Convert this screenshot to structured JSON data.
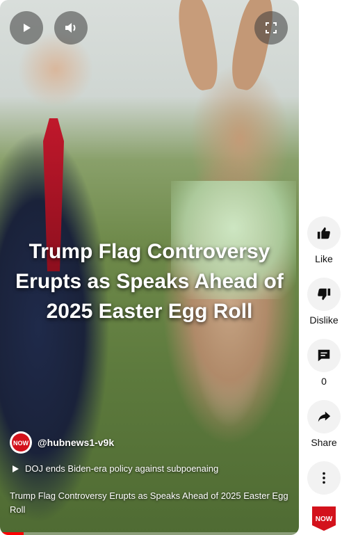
{
  "video": {
    "overlay_title": "Trump Flag Controversy Erupts as Speaks Ahead of 2025 Easter Egg Roll",
    "caption": "Trump Flag Controversy Erupts as Speaks Ahead of 2025 Easter Egg Roll",
    "progress": 0.08,
    "controls": {
      "play_icon": "play-icon",
      "volume_icon": "volume-icon",
      "fullscreen_icon": "fullscreen-icon"
    }
  },
  "channel": {
    "handle": "@hubnews1-v9k",
    "avatar_text": "NOW"
  },
  "related": {
    "text": "DOJ ends Biden-era policy against subpoenaing"
  },
  "actions": {
    "like_label": "Like",
    "dislike_label": "Dislike",
    "comments_count": "0",
    "share_label": "Share",
    "logo_text": "NOW"
  },
  "colors": {
    "accent": "#ff0000",
    "rail_button_bg": "#f2f2f2"
  }
}
